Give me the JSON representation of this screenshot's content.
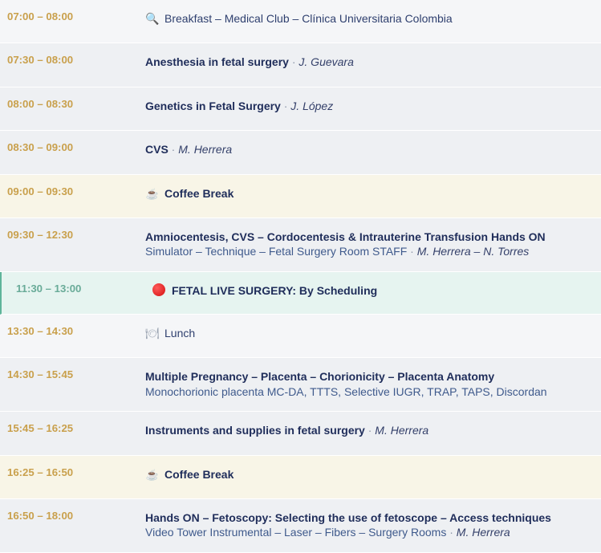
{
  "schedule": [
    {
      "time": "07:00 – 08:00",
      "kind": "plain",
      "icon": "search-icon",
      "text": "Breakfast – Medical Club – Clínica Universitaria Colombia"
    },
    {
      "time": "07:30 – 08:00",
      "kind": "alt",
      "title": "Anesthesia in fetal surgery",
      "sep": " · ",
      "speaker": "J. Guevara"
    },
    {
      "time": "08:00 – 08:30",
      "kind": "alt",
      "title": "Genetics in Fetal Surgery",
      "sep": " · ",
      "speaker": "J. López"
    },
    {
      "time": "08:30 – 09:00",
      "kind": "alt",
      "title": "CVS",
      "sep": " · ",
      "speaker": "M. Herrera"
    },
    {
      "time": "09:00 – 09:30",
      "kind": "break",
      "icon": "coffee-icon",
      "title": "Coffee Break"
    },
    {
      "time": "09:30 – 12:30",
      "kind": "alt",
      "title": "Amniocentesis, CVS – Cordocentesis & Intrauterine Transfusion Hands ON",
      "sub": "Simulator – Technique – Fetal Surgery Room STAFF",
      "sep": " · ",
      "speaker": "M. Herrera – N. Torres"
    },
    {
      "time": "11:30 – 13:00",
      "kind": "live",
      "icon": "live-dot-icon",
      "title": "FETAL LIVE SURGERY: By Scheduling"
    },
    {
      "time": "13:30 – 14:30",
      "kind": "plain",
      "icon": "lunch-icon",
      "text": "Lunch"
    },
    {
      "time": "14:30 – 15:45",
      "kind": "alt",
      "title": "Multiple Pregnancy – Placenta – Chorionicity – Placenta Anatomy",
      "sub": "Monochorionic placenta MC-DA, TTTS, Selective IUGR, TRAP, TAPS, Discordan"
    },
    {
      "time": "15:45 – 16:25",
      "kind": "alt",
      "title": "Instruments and supplies in fetal surgery",
      "sep": " · ",
      "speaker": "M. Herrera"
    },
    {
      "time": "16:25 – 16:50",
      "kind": "break",
      "icon": "coffee-icon",
      "title": "Coffee Break"
    },
    {
      "time": "16:50 – 18:00",
      "kind": "alt",
      "title": "Hands ON – Fetoscopy: Selecting the use of fetoscope – Access techniques",
      "sub": "Video Tower Instrumental – Laser – Fibers – Surgery Rooms",
      "sep": " · ",
      "speaker": "M. Herrera"
    }
  ]
}
